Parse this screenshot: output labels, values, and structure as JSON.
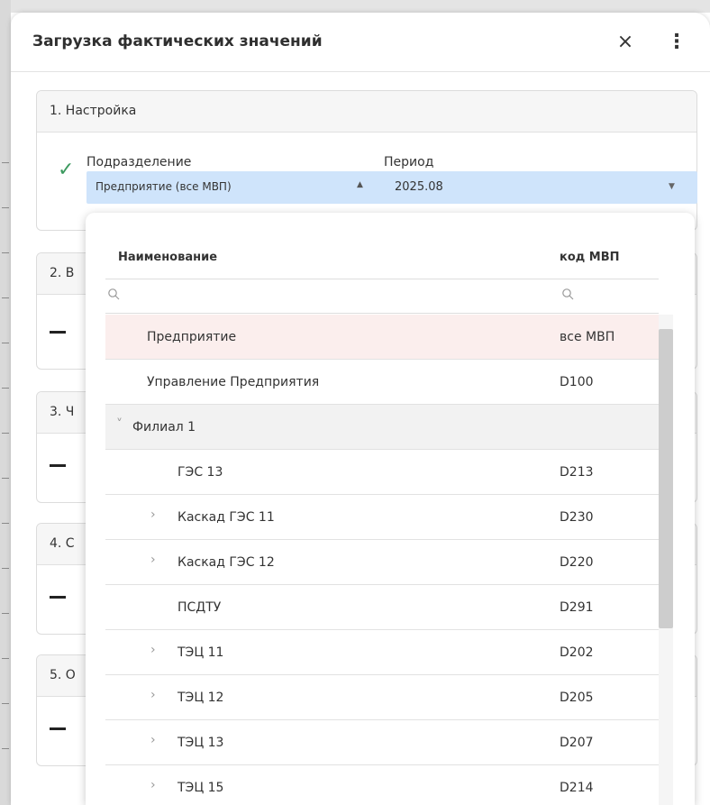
{
  "dialog": {
    "title": "Загрузка фактических значений",
    "close_icon": "×",
    "more_icon": "⋮"
  },
  "sections": [
    {
      "label": "1. Настройка"
    },
    {
      "label": "2. В"
    },
    {
      "label": "3. Ч"
    },
    {
      "label": "4. С"
    },
    {
      "label": "5. О"
    }
  ],
  "settings": {
    "subdivision_label": "Подразделение",
    "period_label": "Период",
    "subdivision_value": "Предприятие (все МВП)",
    "period_value": "2025.08",
    "check_icon": "✓"
  },
  "dropdown": {
    "col_name": "Наименование",
    "col_code": "код МВП",
    "rows": [
      {
        "name": "Предприятие",
        "code": "все МВП",
        "state": "selected",
        "expander": ""
      },
      {
        "name": "Управление Предприятия",
        "code": "D100",
        "state": "",
        "expander": ""
      },
      {
        "name": "Филиал 1",
        "code": "",
        "state": "group",
        "expander": "˅"
      },
      {
        "name": "ГЭС 13",
        "code": "D213",
        "state": "",
        "expander": ""
      },
      {
        "name": "Каскад ГЭС 11",
        "code": "D230",
        "state": "",
        "expander": "›"
      },
      {
        "name": "Каскад ГЭС 12",
        "code": "D220",
        "state": "",
        "expander": "›"
      },
      {
        "name": "ПСДТУ",
        "code": "D291",
        "state": "",
        "expander": ""
      },
      {
        "name": "ТЭЦ 11",
        "code": "D202",
        "state": "",
        "expander": "›"
      },
      {
        "name": "ТЭЦ 12",
        "code": "D205",
        "state": "",
        "expander": "›"
      },
      {
        "name": "ТЭЦ 13",
        "code": "D207",
        "state": "",
        "expander": "›"
      },
      {
        "name": "ТЭЦ 15",
        "code": "D214",
        "state": "",
        "expander": "›"
      }
    ]
  }
}
